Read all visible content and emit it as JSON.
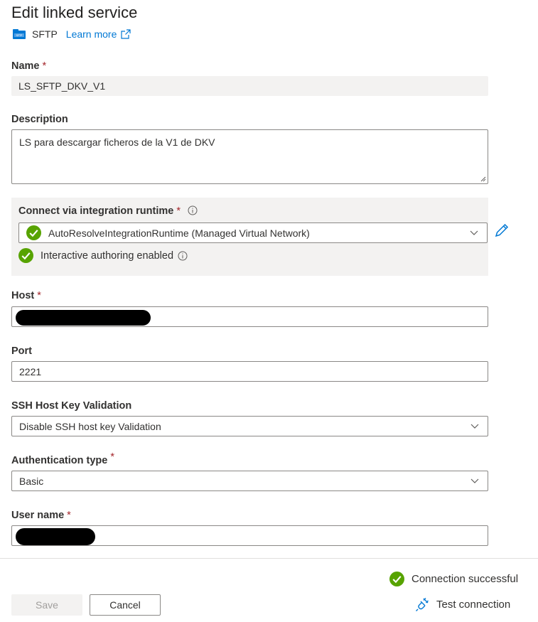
{
  "header": {
    "title": "Edit linked service",
    "service_name": "SFTP",
    "learn_more": "Learn more"
  },
  "form": {
    "name": {
      "label": "Name",
      "required": "*",
      "value": "LS_SFTP_DKV_V1"
    },
    "description": {
      "label": "Description",
      "value": "LS para descargar ficheros de la V1 de DKV"
    },
    "integration_runtime": {
      "label": "Connect via integration runtime",
      "required": "*",
      "selected": "AutoResolveIntegrationRuntime (Managed Virtual Network)",
      "interactive_status": "Interactive authoring enabled"
    },
    "host": {
      "label": "Host",
      "required": "*",
      "value": ""
    },
    "port": {
      "label": "Port",
      "value": "2221"
    },
    "ssh_validation": {
      "label": "SSH Host Key Validation",
      "selected": "Disable SSH host key Validation"
    },
    "auth_type": {
      "label": "Authentication type",
      "required": "*",
      "selected": "Basic"
    },
    "user_name": {
      "label": "User name",
      "required": "*",
      "value": ""
    }
  },
  "footer": {
    "connection_status": "Connection successful",
    "test_connection": "Test connection",
    "save": "Save",
    "cancel": "Cancel"
  },
  "colors": {
    "accent": "#0078d4",
    "success": "#57a300",
    "required": "#a4262c"
  }
}
